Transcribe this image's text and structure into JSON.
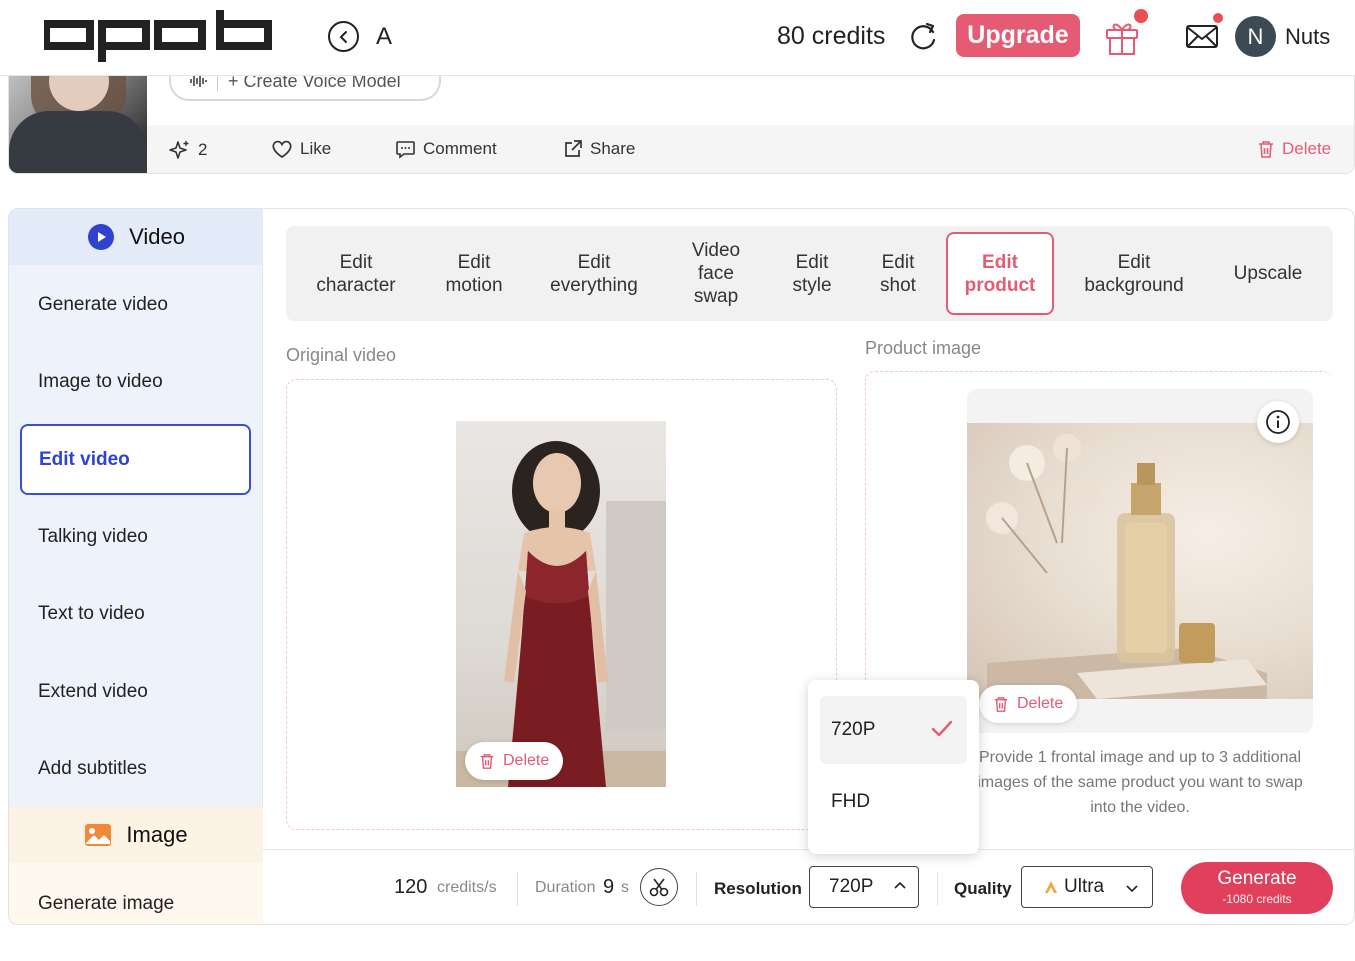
{
  "header": {
    "logo_text": "opob",
    "back_label": "A",
    "credits": "80 credits",
    "upgrade_label": "Upgrade",
    "avatar_initial": "N",
    "user_name": "Nuts",
    "icons": [
      "chevron-left-icon",
      "refresh-icon",
      "gift-icon",
      "mail-icon"
    ],
    "notification_color": "#e94e55"
  },
  "post": {
    "voice_model_label": "+ Create Voice Model",
    "sparkle_count": "2",
    "like_label": "Like",
    "comment_label": "Comment",
    "share_label": "Share",
    "delete_label": "Delete"
  },
  "sidebar": {
    "video_section": "Video",
    "items": [
      "Generate video",
      "Image to video",
      "Edit video",
      "Talking video",
      "Text to video",
      "Extend video",
      "Add subtitles"
    ],
    "active_item": "Edit video",
    "image_section": "Image",
    "image_items": [
      "Generate image"
    ]
  },
  "tabs": [
    {
      "label": "Edit\ncharacter"
    },
    {
      "label": "Edit\nmotion"
    },
    {
      "label": "Edit\neverything"
    },
    {
      "label": "Video\nface\nswap"
    },
    {
      "label": "Edit\nstyle"
    },
    {
      "label": "Edit\nshot"
    },
    {
      "label": "Edit\nproduct"
    },
    {
      "label": "Edit\nbackground"
    },
    {
      "label": "Upscale"
    }
  ],
  "active_tab": "Edit product",
  "original_video": {
    "label": "Original video",
    "delete_label": "Delete"
  },
  "product_image": {
    "label": "Product image",
    "delete_label": "Delete",
    "hint": "Provide 1 frontal image and up to 3 additional images of the same product you want to swap into the video."
  },
  "bottom_bar": {
    "rate_value": "120",
    "rate_unit": "credits/s",
    "duration_label": "Duration",
    "duration_value": "9",
    "duration_unit": "s",
    "resolution_label": "Resolution",
    "resolution_value": "720P",
    "quality_label": "Quality",
    "quality_value": "Ultra",
    "generate_label": "Generate",
    "generate_cost": "-1080 credits"
  },
  "resolution_dropdown": {
    "options": [
      "720P",
      "FHD"
    ],
    "selected": "720P"
  },
  "colors": {
    "accent": "#e65b74",
    "primary_blue": "#3043d0",
    "generate": "#e0405c"
  }
}
